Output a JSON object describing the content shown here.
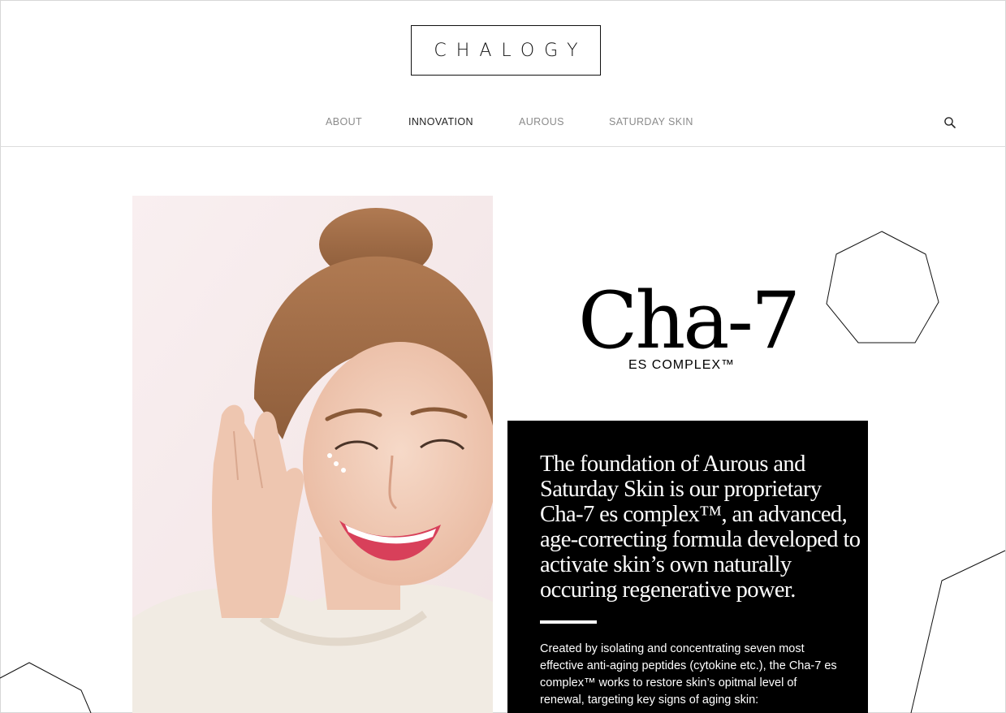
{
  "brand": {
    "logo_text": "CHALOGY"
  },
  "nav": {
    "items": [
      {
        "label": "ABOUT"
      },
      {
        "label": "INNOVATION"
      },
      {
        "label": "AUROUS"
      },
      {
        "label": "SATURDAY SKIN"
      }
    ],
    "active_label": "INNOVATION",
    "search_icon": "search-icon"
  },
  "hero": {
    "photo": "smiling-woman-portrait",
    "complex_title": "Cha-7",
    "complex_subtitle": "ES COMPLEX™"
  },
  "panel": {
    "heading": "The foundation of Aurous and Saturday Skin is our proprietary Cha-7 es complex™, an advanced, age-correcting formula developed to activate skin’s own naturally occuring regenerative power.",
    "body": "Created by isolating and concentrating seven most effective anti-aging peptides (cytokine etc.), the Cha-7 es complex™ works to restore skin’s opitmal level of renewal, targeting key signs of aging skin:"
  },
  "colors": {
    "text": "#000000",
    "nav_inactive": "#8b8b8b",
    "nav_active": "#222222",
    "panel_bg": "#000000",
    "panel_text": "#ffffff",
    "photo_bg": "#f6e8ea"
  }
}
